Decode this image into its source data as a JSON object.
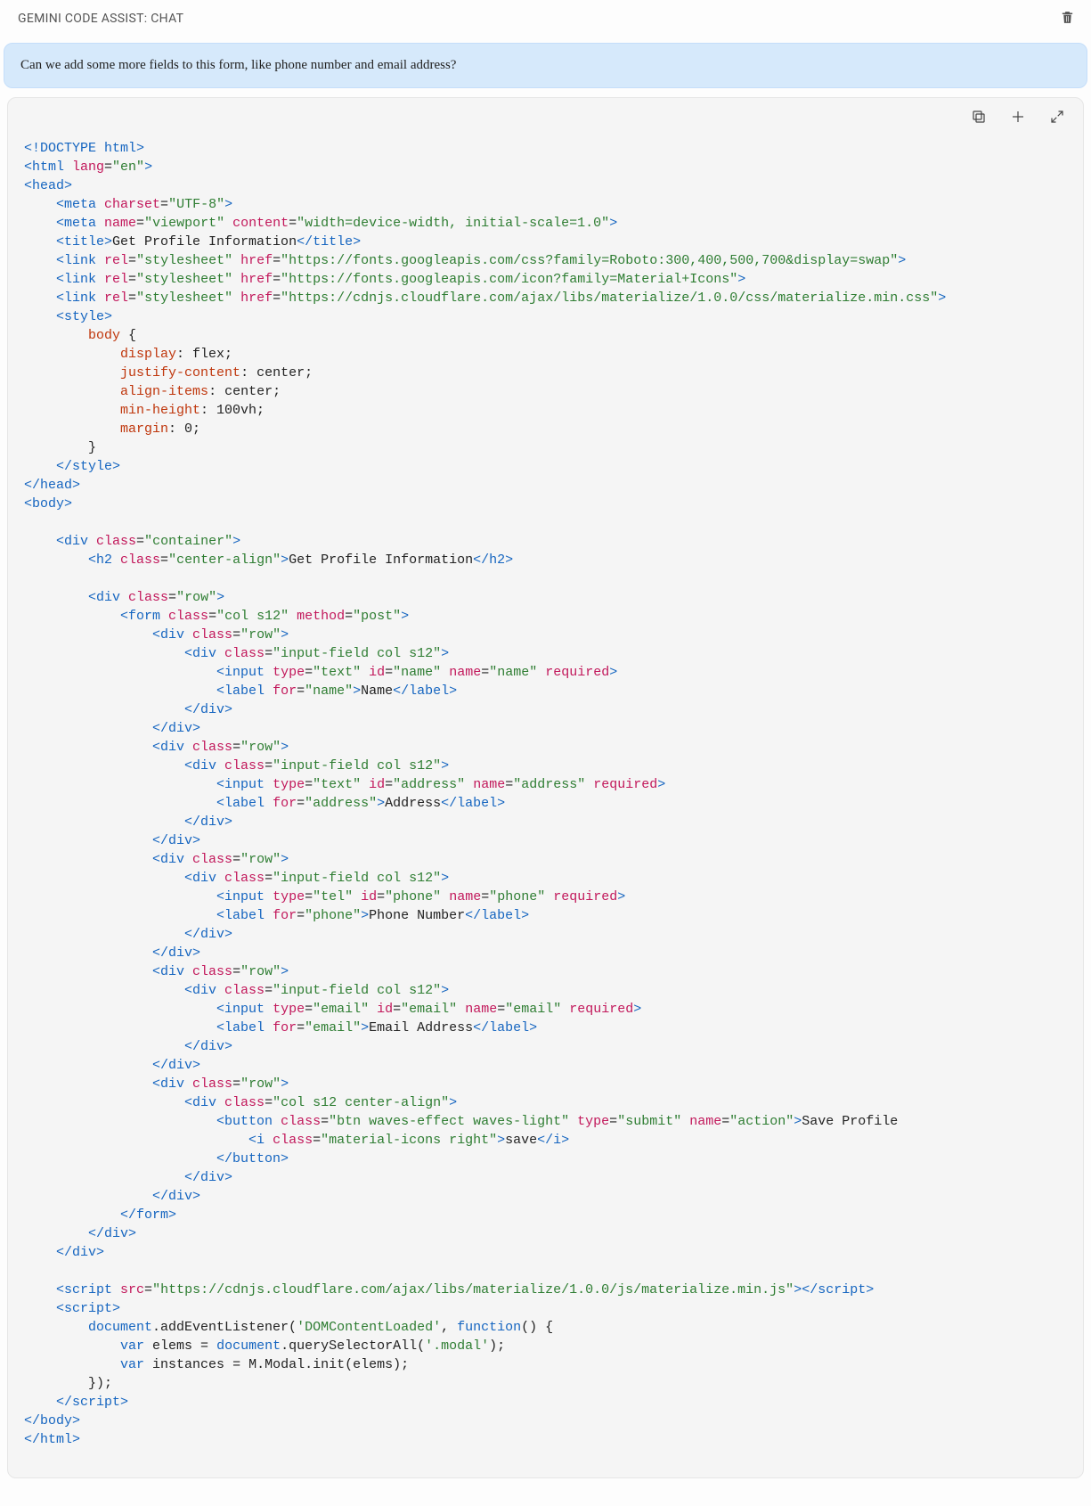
{
  "header": {
    "title": "GEMINI CODE ASSIST: CHAT"
  },
  "user_message": "Can we add some more fields to this form, like phone number and email address?",
  "code_lines": [
    [
      [
        "c-tag",
        "<!DOCTYPE html>"
      ]
    ],
    [
      [
        "c-tag",
        "<html "
      ],
      [
        "c-attr",
        "lang"
      ],
      [
        "c-text",
        "="
      ],
      [
        "c-str",
        "\"en\""
      ],
      [
        "c-tag",
        ">"
      ]
    ],
    [
      [
        "c-tag",
        "<head>"
      ]
    ],
    [
      [
        "c-text",
        "    "
      ],
      [
        "c-tag",
        "<meta "
      ],
      [
        "c-attr",
        "charset"
      ],
      [
        "c-text",
        "="
      ],
      [
        "c-str",
        "\"UTF-8\""
      ],
      [
        "c-tag",
        ">"
      ]
    ],
    [
      [
        "c-text",
        "    "
      ],
      [
        "c-tag",
        "<meta "
      ],
      [
        "c-attr",
        "name"
      ],
      [
        "c-text",
        "="
      ],
      [
        "c-str",
        "\"viewport\""
      ],
      [
        "c-text",
        " "
      ],
      [
        "c-attr",
        "content"
      ],
      [
        "c-text",
        "="
      ],
      [
        "c-str",
        "\"width=device-width, initial-scale=1.0\""
      ],
      [
        "c-tag",
        ">"
      ]
    ],
    [
      [
        "c-text",
        "    "
      ],
      [
        "c-tag",
        "<title>"
      ],
      [
        "c-text",
        "Get Profile Information"
      ],
      [
        "c-tag",
        "</title>"
      ]
    ],
    [
      [
        "c-text",
        "    "
      ],
      [
        "c-tag",
        "<link "
      ],
      [
        "c-attr",
        "rel"
      ],
      [
        "c-text",
        "="
      ],
      [
        "c-str",
        "\"stylesheet\""
      ],
      [
        "c-text",
        " "
      ],
      [
        "c-attr",
        "href"
      ],
      [
        "c-text",
        "="
      ],
      [
        "c-str",
        "\"https://fonts.googleapis.com/css?family=Roboto:300,400,500,700&display=swap\""
      ],
      [
        "c-tag",
        ">"
      ]
    ],
    [
      [
        "c-text",
        "    "
      ],
      [
        "c-tag",
        "<link "
      ],
      [
        "c-attr",
        "rel"
      ],
      [
        "c-text",
        "="
      ],
      [
        "c-str",
        "\"stylesheet\""
      ],
      [
        "c-text",
        " "
      ],
      [
        "c-attr",
        "href"
      ],
      [
        "c-text",
        "="
      ],
      [
        "c-str",
        "\"https://fonts.googleapis.com/icon?family=Material+Icons\""
      ],
      [
        "c-tag",
        ">"
      ]
    ],
    [
      [
        "c-text",
        "    "
      ],
      [
        "c-tag",
        "<link "
      ],
      [
        "c-attr",
        "rel"
      ],
      [
        "c-text",
        "="
      ],
      [
        "c-str",
        "\"stylesheet\""
      ],
      [
        "c-text",
        " "
      ],
      [
        "c-attr",
        "href"
      ],
      [
        "c-text",
        "="
      ],
      [
        "c-str",
        "\"https://cdnjs.cloudflare.com/ajax/libs/materialize/1.0.0/css/materialize.min.css\""
      ],
      [
        "c-tag",
        ">"
      ]
    ],
    [
      [
        "c-text",
        "    "
      ],
      [
        "c-tag",
        "<style>"
      ]
    ],
    [
      [
        "c-text",
        "        "
      ],
      [
        "c-selprop",
        "body"
      ],
      [
        "c-text",
        " {"
      ]
    ],
    [
      [
        "c-text",
        "            "
      ],
      [
        "c-selprop",
        "display"
      ],
      [
        "c-text",
        ": flex;"
      ]
    ],
    [
      [
        "c-text",
        "            "
      ],
      [
        "c-selprop",
        "justify-content"
      ],
      [
        "c-text",
        ": center;"
      ]
    ],
    [
      [
        "c-text",
        "            "
      ],
      [
        "c-selprop",
        "align-items"
      ],
      [
        "c-text",
        ": center;"
      ]
    ],
    [
      [
        "c-text",
        "            "
      ],
      [
        "c-selprop",
        "min-height"
      ],
      [
        "c-text",
        ": 100vh;"
      ]
    ],
    [
      [
        "c-text",
        "            "
      ],
      [
        "c-selprop",
        "margin"
      ],
      [
        "c-text",
        ": 0;"
      ]
    ],
    [
      [
        "c-text",
        "        }"
      ]
    ],
    [
      [
        "c-text",
        "    "
      ],
      [
        "c-tag",
        "</style>"
      ]
    ],
    [
      [
        "c-tag",
        "</head>"
      ]
    ],
    [
      [
        "c-tag",
        "<body>"
      ]
    ],
    [
      [
        "c-text",
        ""
      ]
    ],
    [
      [
        "c-text",
        "    "
      ],
      [
        "c-tag",
        "<div "
      ],
      [
        "c-attr",
        "class"
      ],
      [
        "c-text",
        "="
      ],
      [
        "c-str",
        "\"container\""
      ],
      [
        "c-tag",
        ">"
      ]
    ],
    [
      [
        "c-text",
        "        "
      ],
      [
        "c-tag",
        "<h2 "
      ],
      [
        "c-attr",
        "class"
      ],
      [
        "c-text",
        "="
      ],
      [
        "c-str",
        "\"center-align\""
      ],
      [
        "c-tag",
        ">"
      ],
      [
        "c-text",
        "Get Profile Information"
      ],
      [
        "c-tag",
        "</h2>"
      ]
    ],
    [
      [
        "c-text",
        ""
      ]
    ],
    [
      [
        "c-text",
        "        "
      ],
      [
        "c-tag",
        "<div "
      ],
      [
        "c-attr",
        "class"
      ],
      [
        "c-text",
        "="
      ],
      [
        "c-str",
        "\"row\""
      ],
      [
        "c-tag",
        ">"
      ]
    ],
    [
      [
        "c-text",
        "            "
      ],
      [
        "c-tag",
        "<form "
      ],
      [
        "c-attr",
        "class"
      ],
      [
        "c-text",
        "="
      ],
      [
        "c-str",
        "\"col s12\""
      ],
      [
        "c-text",
        " "
      ],
      [
        "c-attr",
        "method"
      ],
      [
        "c-text",
        "="
      ],
      [
        "c-str",
        "\"post\""
      ],
      [
        "c-tag",
        ">"
      ]
    ],
    [
      [
        "c-text",
        "                "
      ],
      [
        "c-tag",
        "<div "
      ],
      [
        "c-attr",
        "class"
      ],
      [
        "c-text",
        "="
      ],
      [
        "c-str",
        "\"row\""
      ],
      [
        "c-tag",
        ">"
      ]
    ],
    [
      [
        "c-text",
        "                    "
      ],
      [
        "c-tag",
        "<div "
      ],
      [
        "c-attr",
        "class"
      ],
      [
        "c-text",
        "="
      ],
      [
        "c-str",
        "\"input-field col s12\""
      ],
      [
        "c-tag",
        ">"
      ]
    ],
    [
      [
        "c-text",
        "                        "
      ],
      [
        "c-tag",
        "<input "
      ],
      [
        "c-attr",
        "type"
      ],
      [
        "c-text",
        "="
      ],
      [
        "c-str",
        "\"text\""
      ],
      [
        "c-text",
        " "
      ],
      [
        "c-attr",
        "id"
      ],
      [
        "c-text",
        "="
      ],
      [
        "c-str",
        "\"name\""
      ],
      [
        "c-text",
        " "
      ],
      [
        "c-attr",
        "name"
      ],
      [
        "c-text",
        "="
      ],
      [
        "c-str",
        "\"name\""
      ],
      [
        "c-text",
        " "
      ],
      [
        "c-attr",
        "required"
      ],
      [
        "c-tag",
        ">"
      ]
    ],
    [
      [
        "c-text",
        "                        "
      ],
      [
        "c-tag",
        "<label "
      ],
      [
        "c-attr",
        "for"
      ],
      [
        "c-text",
        "="
      ],
      [
        "c-str",
        "\"name\""
      ],
      [
        "c-tag",
        ">"
      ],
      [
        "c-text",
        "Name"
      ],
      [
        "c-tag",
        "</label>"
      ]
    ],
    [
      [
        "c-text",
        "                    "
      ],
      [
        "c-tag",
        "</div>"
      ]
    ],
    [
      [
        "c-text",
        "                "
      ],
      [
        "c-tag",
        "</div>"
      ]
    ],
    [
      [
        "c-text",
        "                "
      ],
      [
        "c-tag",
        "<div "
      ],
      [
        "c-attr",
        "class"
      ],
      [
        "c-text",
        "="
      ],
      [
        "c-str",
        "\"row\""
      ],
      [
        "c-tag",
        ">"
      ]
    ],
    [
      [
        "c-text",
        "                    "
      ],
      [
        "c-tag",
        "<div "
      ],
      [
        "c-attr",
        "class"
      ],
      [
        "c-text",
        "="
      ],
      [
        "c-str",
        "\"input-field col s12\""
      ],
      [
        "c-tag",
        ">"
      ]
    ],
    [
      [
        "c-text",
        "                        "
      ],
      [
        "c-tag",
        "<input "
      ],
      [
        "c-attr",
        "type"
      ],
      [
        "c-text",
        "="
      ],
      [
        "c-str",
        "\"text\""
      ],
      [
        "c-text",
        " "
      ],
      [
        "c-attr",
        "id"
      ],
      [
        "c-text",
        "="
      ],
      [
        "c-str",
        "\"address\""
      ],
      [
        "c-text",
        " "
      ],
      [
        "c-attr",
        "name"
      ],
      [
        "c-text",
        "="
      ],
      [
        "c-str",
        "\"address\""
      ],
      [
        "c-text",
        " "
      ],
      [
        "c-attr",
        "required"
      ],
      [
        "c-tag",
        ">"
      ]
    ],
    [
      [
        "c-text",
        "                        "
      ],
      [
        "c-tag",
        "<label "
      ],
      [
        "c-attr",
        "for"
      ],
      [
        "c-text",
        "="
      ],
      [
        "c-str",
        "\"address\""
      ],
      [
        "c-tag",
        ">"
      ],
      [
        "c-text",
        "Address"
      ],
      [
        "c-tag",
        "</label>"
      ]
    ],
    [
      [
        "c-text",
        "                    "
      ],
      [
        "c-tag",
        "</div>"
      ]
    ],
    [
      [
        "c-text",
        "                "
      ],
      [
        "c-tag",
        "</div>"
      ]
    ],
    [
      [
        "c-text",
        "                "
      ],
      [
        "c-tag",
        "<div "
      ],
      [
        "c-attr",
        "class"
      ],
      [
        "c-text",
        "="
      ],
      [
        "c-str",
        "\"row\""
      ],
      [
        "c-tag",
        ">"
      ]
    ],
    [
      [
        "c-text",
        "                    "
      ],
      [
        "c-tag",
        "<div "
      ],
      [
        "c-attr",
        "class"
      ],
      [
        "c-text",
        "="
      ],
      [
        "c-str",
        "\"input-field col s12\""
      ],
      [
        "c-tag",
        ">"
      ]
    ],
    [
      [
        "c-text",
        "                        "
      ],
      [
        "c-tag",
        "<input "
      ],
      [
        "c-attr",
        "type"
      ],
      [
        "c-text",
        "="
      ],
      [
        "c-str",
        "\"tel\""
      ],
      [
        "c-text",
        " "
      ],
      [
        "c-attr",
        "id"
      ],
      [
        "c-text",
        "="
      ],
      [
        "c-str",
        "\"phone\""
      ],
      [
        "c-text",
        " "
      ],
      [
        "c-attr",
        "name"
      ],
      [
        "c-text",
        "="
      ],
      [
        "c-str",
        "\"phone\""
      ],
      [
        "c-text",
        " "
      ],
      [
        "c-attr",
        "required"
      ],
      [
        "c-tag",
        ">"
      ]
    ],
    [
      [
        "c-text",
        "                        "
      ],
      [
        "c-tag",
        "<label "
      ],
      [
        "c-attr",
        "for"
      ],
      [
        "c-text",
        "="
      ],
      [
        "c-str",
        "\"phone\""
      ],
      [
        "c-tag",
        ">"
      ],
      [
        "c-text",
        "Phone Number"
      ],
      [
        "c-tag",
        "</label>"
      ]
    ],
    [
      [
        "c-text",
        "                    "
      ],
      [
        "c-tag",
        "</div>"
      ]
    ],
    [
      [
        "c-text",
        "                "
      ],
      [
        "c-tag",
        "</div>"
      ]
    ],
    [
      [
        "c-text",
        "                "
      ],
      [
        "c-tag",
        "<div "
      ],
      [
        "c-attr",
        "class"
      ],
      [
        "c-text",
        "="
      ],
      [
        "c-str",
        "\"row\""
      ],
      [
        "c-tag",
        ">"
      ]
    ],
    [
      [
        "c-text",
        "                    "
      ],
      [
        "c-tag",
        "<div "
      ],
      [
        "c-attr",
        "class"
      ],
      [
        "c-text",
        "="
      ],
      [
        "c-str",
        "\"input-field col s12\""
      ],
      [
        "c-tag",
        ">"
      ]
    ],
    [
      [
        "c-text",
        "                        "
      ],
      [
        "c-tag",
        "<input "
      ],
      [
        "c-attr",
        "type"
      ],
      [
        "c-text",
        "="
      ],
      [
        "c-str",
        "\"email\""
      ],
      [
        "c-text",
        " "
      ],
      [
        "c-attr",
        "id"
      ],
      [
        "c-text",
        "="
      ],
      [
        "c-str",
        "\"email\""
      ],
      [
        "c-text",
        " "
      ],
      [
        "c-attr",
        "name"
      ],
      [
        "c-text",
        "="
      ],
      [
        "c-str",
        "\"email\""
      ],
      [
        "c-text",
        " "
      ],
      [
        "c-attr",
        "required"
      ],
      [
        "c-tag",
        ">"
      ]
    ],
    [
      [
        "c-text",
        "                        "
      ],
      [
        "c-tag",
        "<label "
      ],
      [
        "c-attr",
        "for"
      ],
      [
        "c-text",
        "="
      ],
      [
        "c-str",
        "\"email\""
      ],
      [
        "c-tag",
        ">"
      ],
      [
        "c-text",
        "Email Address"
      ],
      [
        "c-tag",
        "</label>"
      ]
    ],
    [
      [
        "c-text",
        "                    "
      ],
      [
        "c-tag",
        "</div>"
      ]
    ],
    [
      [
        "c-text",
        "                "
      ],
      [
        "c-tag",
        "</div>"
      ]
    ],
    [
      [
        "c-text",
        "                "
      ],
      [
        "c-tag",
        "<div "
      ],
      [
        "c-attr",
        "class"
      ],
      [
        "c-text",
        "="
      ],
      [
        "c-str",
        "\"row\""
      ],
      [
        "c-tag",
        ">"
      ]
    ],
    [
      [
        "c-text",
        "                    "
      ],
      [
        "c-tag",
        "<div "
      ],
      [
        "c-attr",
        "class"
      ],
      [
        "c-text",
        "="
      ],
      [
        "c-str",
        "\"col s12 center-align\""
      ],
      [
        "c-tag",
        ">"
      ]
    ],
    [
      [
        "c-text",
        "                        "
      ],
      [
        "c-tag",
        "<button "
      ],
      [
        "c-attr",
        "class"
      ],
      [
        "c-text",
        "="
      ],
      [
        "c-str",
        "\"btn waves-effect waves-light\""
      ],
      [
        "c-text",
        " "
      ],
      [
        "c-attr",
        "type"
      ],
      [
        "c-text",
        "="
      ],
      [
        "c-str",
        "\"submit\""
      ],
      [
        "c-text",
        " "
      ],
      [
        "c-attr",
        "name"
      ],
      [
        "c-text",
        "="
      ],
      [
        "c-str",
        "\"action\""
      ],
      [
        "c-tag",
        ">"
      ],
      [
        "c-text",
        "Save Profile"
      ]
    ],
    [
      [
        "c-text",
        "                            "
      ],
      [
        "c-tag",
        "<i "
      ],
      [
        "c-attr",
        "class"
      ],
      [
        "c-text",
        "="
      ],
      [
        "c-str",
        "\"material-icons right\""
      ],
      [
        "c-tag",
        ">"
      ],
      [
        "c-text",
        "save"
      ],
      [
        "c-tag",
        "</i>"
      ]
    ],
    [
      [
        "c-text",
        "                        "
      ],
      [
        "c-tag",
        "</button>"
      ]
    ],
    [
      [
        "c-text",
        "                    "
      ],
      [
        "c-tag",
        "</div>"
      ]
    ],
    [
      [
        "c-text",
        "                "
      ],
      [
        "c-tag",
        "</div>"
      ]
    ],
    [
      [
        "c-text",
        "            "
      ],
      [
        "c-tag",
        "</form>"
      ]
    ],
    [
      [
        "c-text",
        "        "
      ],
      [
        "c-tag",
        "</div>"
      ]
    ],
    [
      [
        "c-text",
        "    "
      ],
      [
        "c-tag",
        "</div>"
      ]
    ],
    [
      [
        "c-text",
        ""
      ]
    ],
    [
      [
        "c-text",
        "    "
      ],
      [
        "c-tag",
        "<script "
      ],
      [
        "c-attr",
        "src"
      ],
      [
        "c-text",
        "="
      ],
      [
        "c-str",
        "\"https://cdnjs.cloudflare.com/ajax/libs/materialize/1.0.0/js/materialize.min.js\""
      ],
      [
        "c-tag",
        "></script>"
      ]
    ],
    [
      [
        "c-text",
        "    "
      ],
      [
        "c-tag",
        "<script>"
      ]
    ],
    [
      [
        "c-text",
        "        "
      ],
      [
        "c-var",
        "document"
      ],
      [
        "c-text",
        ".addEventListener("
      ],
      [
        "c-str",
        "'DOMContentLoaded'"
      ],
      [
        "c-text",
        ", "
      ],
      [
        "c-kw",
        "function"
      ],
      [
        "c-text",
        "() {"
      ]
    ],
    [
      [
        "c-text",
        "            "
      ],
      [
        "c-kw",
        "var"
      ],
      [
        "c-text",
        " elems = "
      ],
      [
        "c-var",
        "document"
      ],
      [
        "c-text",
        ".querySelectorAll("
      ],
      [
        "c-str",
        "'.modal'"
      ],
      [
        "c-text",
        ");"
      ]
    ],
    [
      [
        "c-text",
        "            "
      ],
      [
        "c-kw",
        "var"
      ],
      [
        "c-text",
        " instances = M.Modal.init(elems);"
      ]
    ],
    [
      [
        "c-text",
        "        });"
      ]
    ],
    [
      [
        "c-text",
        "    "
      ],
      [
        "c-tag",
        "</script>"
      ]
    ],
    [
      [
        "c-tag",
        "</body>"
      ]
    ],
    [
      [
        "c-tag",
        "</html>"
      ]
    ]
  ]
}
